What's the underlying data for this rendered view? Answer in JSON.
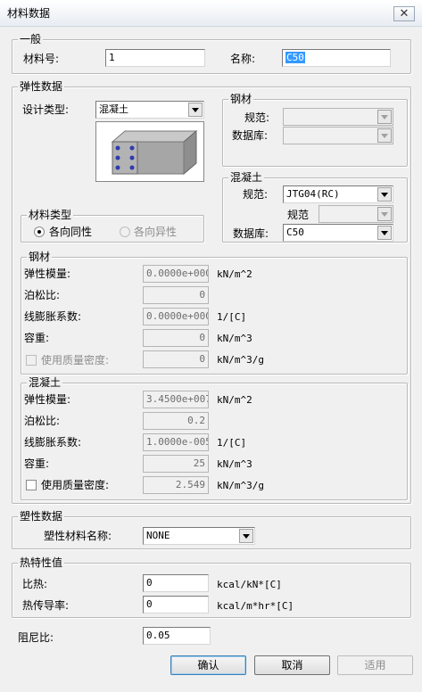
{
  "window": {
    "title": "材料数据",
    "close_glyph": "✕"
  },
  "general": {
    "legend": "一般",
    "material_no_label": "材料号:",
    "material_no_value": "1",
    "name_label": "名称:",
    "name_value": "C50"
  },
  "elastic": {
    "legend": "弹性数据",
    "design_type_label": "设计类型:",
    "design_type_value": "混凝土",
    "image_icon": "concrete-column-icon",
    "material_type": {
      "legend": "材料类型",
      "isotropic_label": "各向同性",
      "orthotropic_label": "各向异性",
      "selected": "各向同性"
    },
    "steel_box": {
      "legend": "钢材",
      "standard_label": "规范:",
      "standard_value": "",
      "database_label": "数据库:",
      "database_value": ""
    },
    "concrete_box": {
      "legend": "混凝土",
      "standard_label": "规范:",
      "standard_value": "JTG04(RC)",
      "sub_standard_label": "规范",
      "sub_standard_value": "",
      "database_label": "数据库:",
      "database_value": "C50"
    },
    "steel_props": {
      "legend": "钢材",
      "modulus_label": "弹性模量:",
      "modulus_value": "0.0000e+000",
      "modulus_unit": "kN/m^2",
      "poisson_label": "泊松比:",
      "poisson_value": "0",
      "thermal_label": "线膨胀系数:",
      "thermal_value": "0.0000e+000",
      "thermal_unit": "1/[C]",
      "weight_label": "容重:",
      "weight_value": "0",
      "weight_unit": "kN/m^3",
      "mass_label": "使用质量密度:",
      "mass_value": "0",
      "mass_unit": "kN/m^3/g"
    },
    "concrete_props": {
      "legend": "混凝土",
      "modulus_label": "弹性模量:",
      "modulus_value": "3.4500e+007",
      "modulus_unit": "kN/m^2",
      "poisson_label": "泊松比:",
      "poisson_value": "0.2",
      "thermal_label": "线膨胀系数:",
      "thermal_value": "1.0000e-005",
      "thermal_unit": "1/[C]",
      "weight_label": "容重:",
      "weight_value": "25",
      "weight_unit": "kN/m^3",
      "mass_label": "使用质量密度:",
      "mass_value": "2.549",
      "mass_unit": "kN/m^3/g"
    }
  },
  "plastic": {
    "legend": "塑性数据",
    "name_label": "塑性材料名称:",
    "name_value": "NONE"
  },
  "thermal": {
    "legend": "热特性值",
    "specific_heat_label": "比热:",
    "specific_heat_value": "0",
    "specific_heat_unit": "kcal/kN*[C]",
    "conductivity_label": "热传导率:",
    "conductivity_value": "0",
    "conductivity_unit": "kcal/m*hr*[C]"
  },
  "damping": {
    "label": "阻尼比:",
    "value": "0.05"
  },
  "buttons": {
    "ok": "确认",
    "cancel": "取消",
    "apply": "适用"
  }
}
